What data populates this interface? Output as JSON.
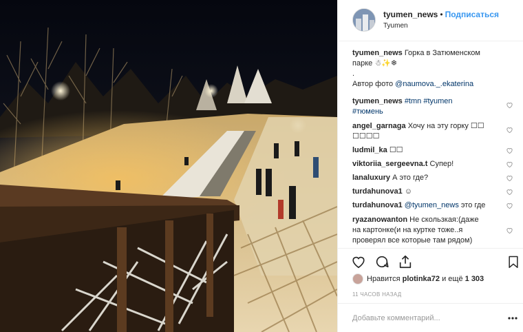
{
  "post": {
    "username": "tyumen_news",
    "separator": "•",
    "follow_label": "Подписаться",
    "location": "Tyumen"
  },
  "caption": {
    "username": "tyumen_news",
    "text_line1": "Горка в Затюменском",
    "text_line2": "парке",
    "emoji": "☃✨❄",
    "dot": ".",
    "credit_prefix": "Автор фото",
    "credit_mention": "@naumova._.ekaterina"
  },
  "comments": [
    {
      "user": "tyumen_news",
      "tags": "#tmn #tyumen",
      "tags2": "#тюмень"
    },
    {
      "user": "angel_garnaga",
      "text": "Хочу на эту горку ☐☐",
      "text2": "☐☐☐☐"
    },
    {
      "user": "ludmil_ka",
      "text": "☐☐"
    },
    {
      "user": "viktoriia_sergeevna.t",
      "text": "Супер!"
    },
    {
      "user": "lanaluxury",
      "text": "А это где?"
    },
    {
      "user": "turdahunova1",
      "text": "☺"
    },
    {
      "user": "turdahunova1",
      "mention": "@tyumen_news",
      "text": "это где"
    },
    {
      "user": "ryazanowanton",
      "text": "Не скользкая:(даже",
      "text2": "на картонке(и на куртке тоже..я",
      "text3": "проверял все которые там рядом)"
    }
  ],
  "likes": {
    "prefix": "Нравится",
    "user": "plotinka72",
    "middle": "и ещё",
    "count": "1 303"
  },
  "time_ago": "11 ЧАСОВ НАЗАД",
  "add_comment": {
    "placeholder": "Добавьте комментарий..."
  },
  "icons": {
    "like": "heart-icon",
    "comment": "comment-icon",
    "share": "share-icon",
    "save": "bookmark-icon",
    "more": "more-icon"
  }
}
